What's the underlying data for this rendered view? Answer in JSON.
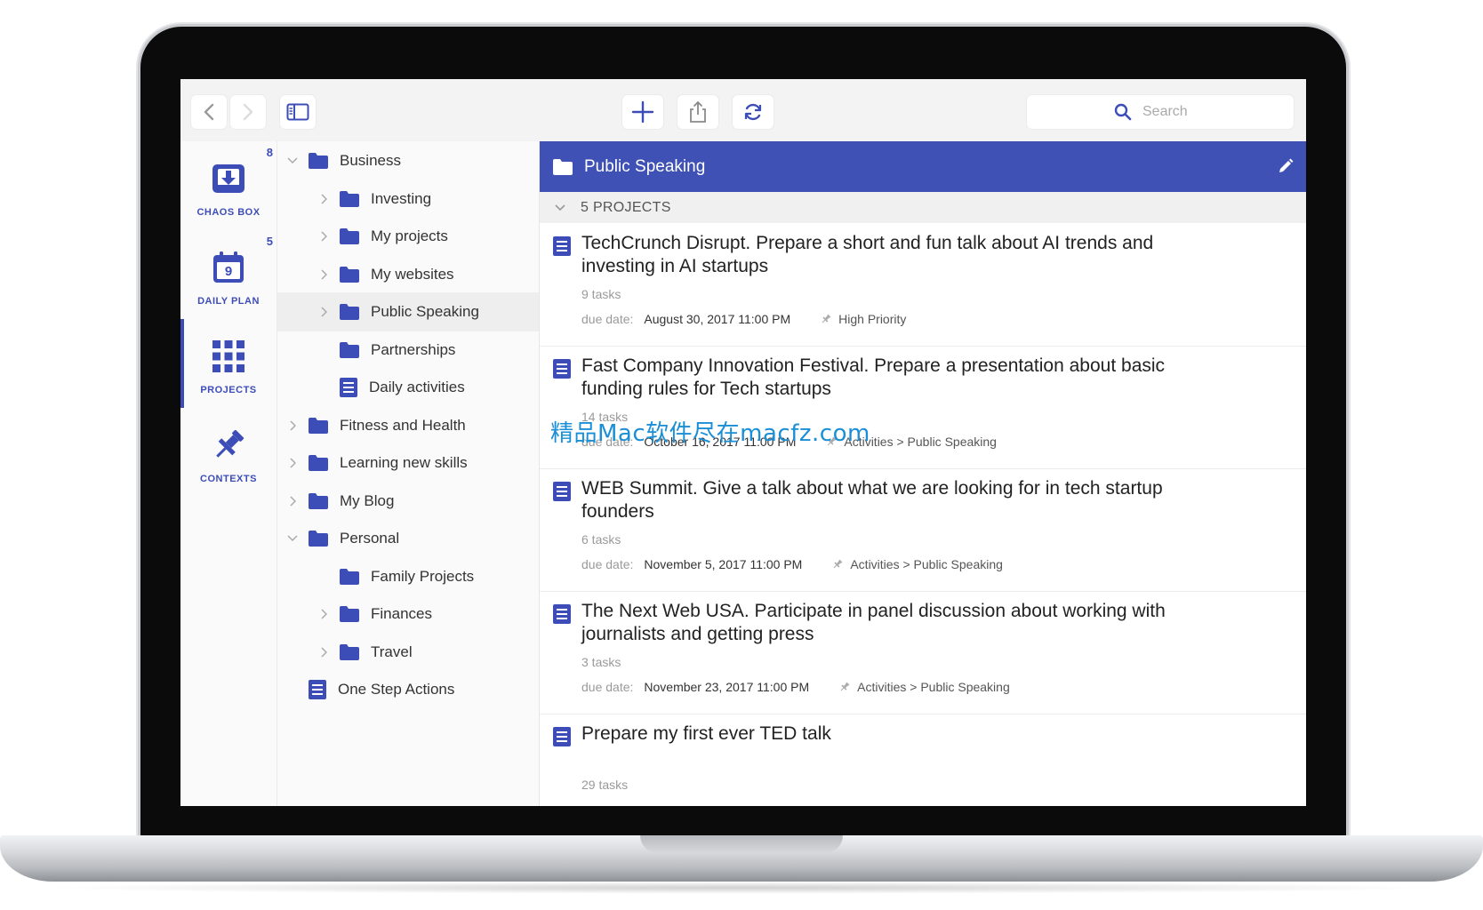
{
  "toolbar": {
    "back_icon": "chevron-left-icon",
    "forward_icon": "chevron-right-icon",
    "sidebar_icon": "sidebar-toggle-icon",
    "add_icon": "plus-icon",
    "share_icon": "share-icon",
    "sync_icon": "sync-icon",
    "search_placeholder": "Search"
  },
  "rail": {
    "items": [
      {
        "label": "CHAOS BOX",
        "icon": "inbox-download-icon",
        "badge": "8"
      },
      {
        "label": "DAILY PLAN",
        "icon": "calendar-icon",
        "badge": "5",
        "day": "9"
      },
      {
        "label": "PROJECTS",
        "icon": "grid-icon",
        "badge": ""
      },
      {
        "label": "CONTEXTS",
        "icon": "pin-icon",
        "badge": ""
      }
    ]
  },
  "tree": {
    "items": [
      {
        "name": "Business",
        "level": 0,
        "type": "folder",
        "expanded": true
      },
      {
        "name": "Investing",
        "level": 1,
        "type": "folder"
      },
      {
        "name": "My projects",
        "level": 1,
        "type": "folder"
      },
      {
        "name": "My websites",
        "level": 1,
        "type": "folder"
      },
      {
        "name": "Public Speaking",
        "level": 1,
        "type": "folder",
        "selected": true
      },
      {
        "name": "Partnerships",
        "level": 1,
        "type": "folder"
      },
      {
        "name": "Daily activities",
        "level": 1,
        "type": "doc"
      },
      {
        "name": "Fitness and Health",
        "level": 0,
        "type": "folder"
      },
      {
        "name": "Learning new skills",
        "level": 0,
        "type": "folder"
      },
      {
        "name": "My Blog",
        "level": 0,
        "type": "folder"
      },
      {
        "name": "Personal",
        "level": 0,
        "type": "folder",
        "expanded": true
      },
      {
        "name": "Family Projects",
        "level": 1,
        "type": "folder"
      },
      {
        "name": "Finances",
        "level": 1,
        "type": "folder"
      },
      {
        "name": "Travel",
        "level": 1,
        "type": "folder"
      },
      {
        "name": "One Step Actions",
        "level": 0,
        "type": "doc"
      }
    ]
  },
  "main": {
    "header_title": "Public Speaking",
    "count_label": "5 PROJECTS",
    "projects": [
      {
        "title": "TechCrunch Disrupt. Prepare a short and fun talk about AI trends and investing in AI startups",
        "tasks": "9 tasks",
        "due_label": "due date:",
        "due": "August 30, 2017 11:00 PM",
        "context": "High Priority"
      },
      {
        "title": "Fast Company Innovation Festival. Prepare a presentation about basic funding rules for Tech startups",
        "tasks": "14 tasks",
        "due_label": "due date:",
        "due": "October 16, 2017 11:00 PM",
        "context": "Activities > Public Speaking"
      },
      {
        "title": "WEB Summit. Give a talk about what we are looking for in tech startup founders",
        "tasks": "6 tasks",
        "due_label": "due date:",
        "due": "November 5, 2017 11:00 PM",
        "context": "Activities > Public Speaking"
      },
      {
        "title": "The Next Web USA. Participate in panel discussion about working with journalists and getting press",
        "tasks": "3 tasks",
        "due_label": "due date:",
        "due": "November 23, 2017 11:00 PM",
        "context": "Activities > Public Speaking"
      },
      {
        "title": "Prepare my first ever TED talk",
        "tasks": "29 tasks",
        "due_label": "",
        "due": "",
        "context": ""
      }
    ]
  },
  "watermark": "精品Mac软件尽在macfz.com",
  "colors": {
    "accent": "#3f51b5",
    "icon_blue": "#3d4db7"
  }
}
